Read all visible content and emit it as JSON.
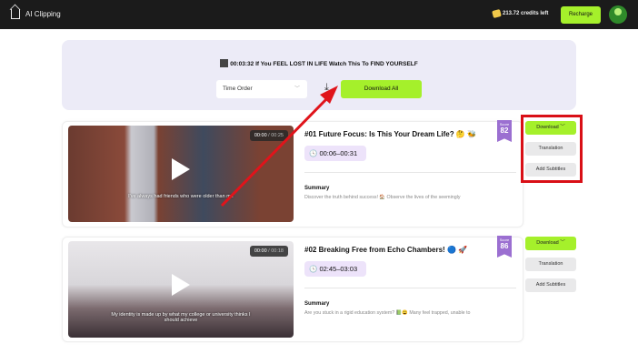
{
  "header": {
    "app_title": "AI Clipping",
    "credits": "213.72 credits left",
    "recharge_label": "Recharge"
  },
  "panel": {
    "video_title": "00:03:32 If You FEEL LOST IN LIFE Watch This To FIND YOURSELF",
    "sort_select": "Time Order",
    "download_all_label": "Download All"
  },
  "clips": [
    {
      "title": "#01 Future Focus: Is This Your Dream Life? 🤔 🐝",
      "score_label": "Score",
      "score": "82",
      "time_range": "00:06–00:31",
      "video_current": "00:00",
      "video_duration": "/ 00:25",
      "subtitle": "I've always had friends who were older than me",
      "summary_label": "Summary",
      "summary": "Discover the truth behind success! 🏠 Observe the lives of the seemingly",
      "download_label": "Download",
      "translation_label": "Translation",
      "subtitles_label": "Add Subtitles"
    },
    {
      "title": "#02 Breaking Free from Echo Chambers! 🔵 🚀",
      "score_label": "Score",
      "score": "86",
      "time_range": "02:45–03:03",
      "video_current": "00:00",
      "video_duration": "/ 00:18",
      "subtitle": "My identity is made up by what my college or university thinks I should achieve",
      "summary_label": "Summary",
      "summary": "Are you stuck in a rigid education system? 📗😩 Many feel trapped, unable to",
      "download_label": "Download",
      "translation_label": "Translation",
      "subtitles_label": "Add Subtitles"
    }
  ],
  "colors": {
    "accent": "#a5f02b",
    "header_bg": "#1b1b1b",
    "panel_bg": "#ecebf7",
    "score_badge": "#9b6fd1",
    "annotation": "#d90f16"
  }
}
